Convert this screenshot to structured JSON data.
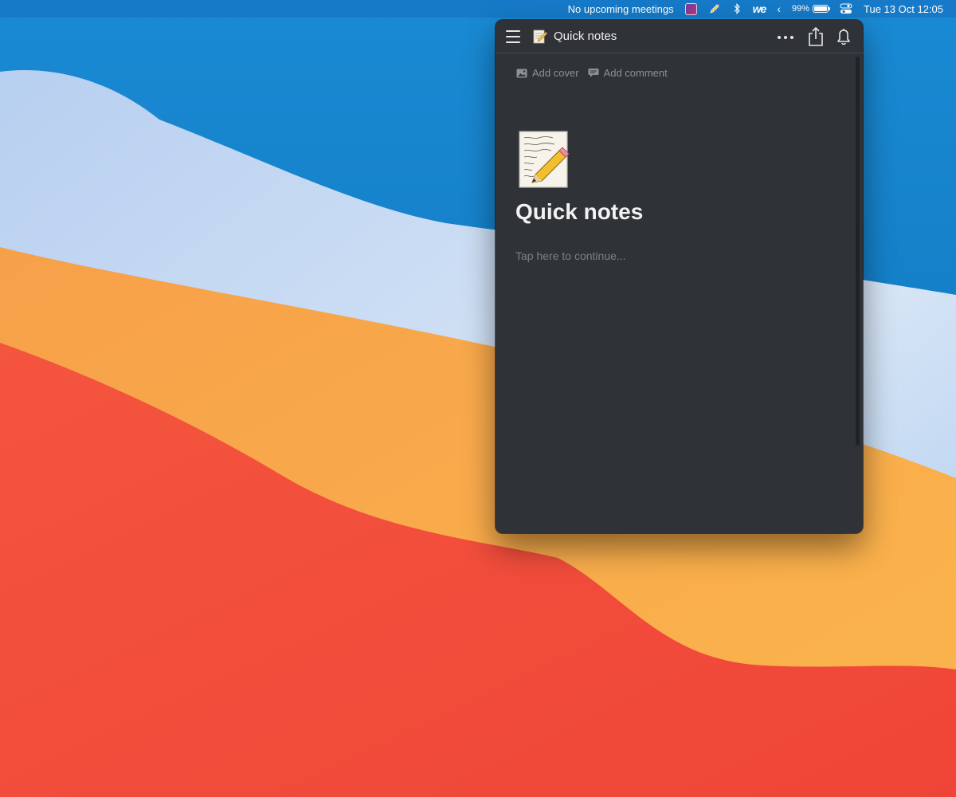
{
  "menubar": {
    "meetings": "No upcoming meetings",
    "battery_percent": "99%",
    "battery_level": 0.99,
    "datetime": "Tue 13 Oct  12:05",
    "icons": [
      "app-icon",
      "pencil-icon",
      "bluetooth-icon",
      "we-icon",
      "chevron-left-icon",
      "battery-icon",
      "control-center-icon"
    ]
  },
  "popover": {
    "title": "Quick notes",
    "page_emoji": "memo",
    "actions": {
      "add_cover": "Add cover",
      "add_comment": "Add comment"
    },
    "heading": "Quick notes",
    "placeholder": "Tap here to continue..."
  },
  "colors": {
    "popover_bg": "#2f3337",
    "text_primary": "#f2f2f2",
    "text_muted": "#8d9196",
    "wallpaper_blue": "#0a78c2",
    "wallpaper_orange": "#f79a3a",
    "wallpaper_red": "#f04b3c"
  }
}
